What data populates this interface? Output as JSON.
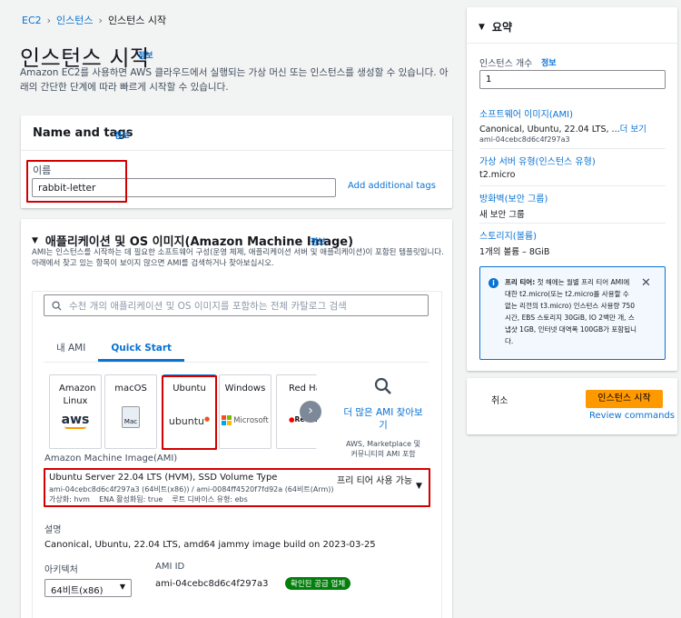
{
  "breadcrumb": [
    "EC2",
    "인스턴스",
    "인스턴스 시작"
  ],
  "page": {
    "title": "인스턴스 시작",
    "info": "정보",
    "description": "Amazon EC2를 사용하면 AWS 클라우드에서 실행되는 가상 머신 또는 인스턴스를 생성할 수 있습니다. 아래의 간단한 단계에 따라 빠르게 시작할 수 있습니다."
  },
  "name_tags": {
    "title": "Name and tags",
    "info": "정보",
    "name_label": "이름",
    "name_value": "rabbit-letter",
    "add_tags": "Add additional tags"
  },
  "ami": {
    "title": "애플리케이션 및 OS 이미지(Amazon Machine Image)",
    "info": "정보",
    "description": "AMI는 인스턴스를 시작하는 데 필요한 소프트웨어 구성(운영 체제, 애플리케이션 서버 및 애플리케이션)이 포함된 템플릿입니다. 아래에서 찾고 있는 항목이 보이지 않으면 AMI를 검색하거나 찾아보십시오.",
    "search_placeholder": "수천 개의 애플리케이션 및 OS 이미지를 포함하는 전체 카탈로그 검색",
    "tabs": [
      "내 AMI",
      "Quick Start"
    ],
    "os_cards": [
      {
        "label": "Amazon Linux",
        "logo": "aws"
      },
      {
        "label": "macOS",
        "logo": "Mac"
      },
      {
        "label": "Ubuntu",
        "logo": "ubuntu"
      },
      {
        "label": "Windows",
        "logo": "Microsoft"
      },
      {
        "label": "Red Hat",
        "logo": "Red Hat"
      }
    ],
    "more_link": "더 많은 AMI 찾아보기",
    "more_sub": "AWS, Marketplace 및 커뮤니티의 AMI 포함",
    "ami_label": "Amazon Machine Image(AMI)",
    "selected_name": "Ubuntu Server 22.04 LTS (HVM), SSD Volume Type",
    "selected_free": "프리 티어 사용 가능",
    "selected_id": "ami-04cebc8d6c4f297a3 (64비트(x86)) / ami-0084ff4520f7fd92a (64비트(Arm))",
    "selected_attrs": "가상화: hvm    ENA 활성화됨: true    루트 디바이스 유형: ebs",
    "desc_label": "설명",
    "desc_value": "Canonical, Ubuntu, 22.04 LTS, amd64 jammy image build on 2023-03-25",
    "arch_label": "아키텍처",
    "arch_value": "64비트(x86)",
    "amiid_label": "AMI ID",
    "amiid_value": "ami-04cebc8d6c4f297a3",
    "verified": "확인된 공급 업체"
  },
  "summary": {
    "title": "요약",
    "count_label": "인스턴스 개수",
    "count_info": "정보",
    "count_value": "1",
    "software_label": "소프트웨어 이미지(AMI)",
    "software_value": "Canonical, Ubuntu, 22.04 LTS, ...",
    "software_more": "더 보기",
    "software_id": "ami-04cebc8d6c4f297a3",
    "server_label": "가상 서버 유형(인스턴스 유형)",
    "server_value": "t2.micro",
    "firewall_label": "방화벽(보안 그룹)",
    "firewall_value": "새 보안 그룹",
    "storage_label": "스토리지(볼륨)",
    "storage_value": "1개의 볼륨 – 8GiB",
    "free_tier_bold": "프리 티어:",
    "free_tier_text": " 첫 해에는 월별 프리 티어 AMI에 대한 t2.micro(또는 t2.micro를 사용할 수 없는 리전의 t3.micro) 인스턴스 사용량 750시간, EBS 스토리지 30GiB, IO 2백만 개, 스냅샷 1GB, 인터넷 대역폭 100GB가 포함됩니다.",
    "cancel": "취소",
    "launch": "인스턴스 시작",
    "review": "Review commands"
  },
  "colors": {
    "accent": "#0972d3",
    "launch": "#ff9900",
    "highlight": "#d40000",
    "verified": "#037f0c"
  }
}
